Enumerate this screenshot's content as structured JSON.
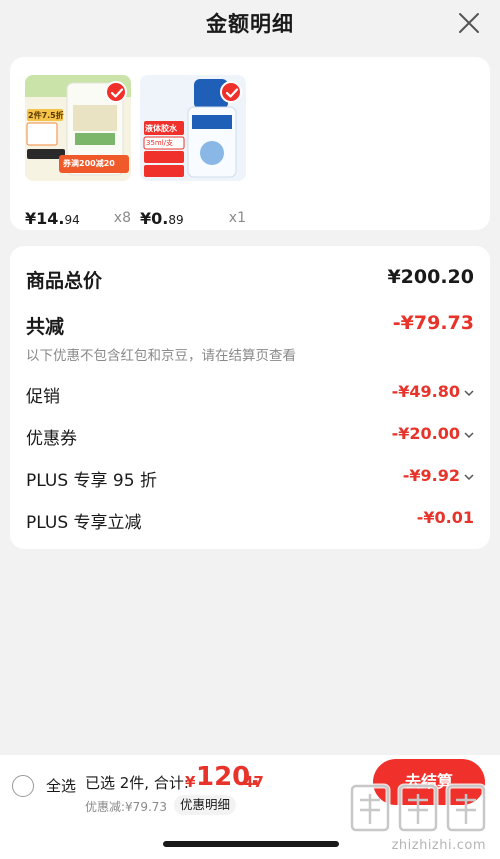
{
  "header": {
    "title": "金额明细"
  },
  "products": [
    {
      "name": "product-milk-powder",
      "price_int": "¥14.",
      "price_dec": "94",
      "qty": "x8",
      "badge": "2件7.5折",
      "promo_text": "券满200减20"
    },
    {
      "name": "product-liquid-glue",
      "price_int": "¥0.",
      "price_dec": "89",
      "qty": "x1",
      "badge": "液体胶水",
      "promo_text": "35ml/支"
    }
  ],
  "summary": {
    "total_label": "商品总价",
    "total_value": "¥200.20",
    "reduce_label": "共减",
    "reduce_value": "-¥79.73",
    "note": "以下优惠不包含红包和京豆，请在结算页查看",
    "items": [
      {
        "label": "促销",
        "value": "-¥49.80"
      },
      {
        "label": "优惠券",
        "value": "-¥20.00"
      },
      {
        "label": "PLUS 专享 95 折",
        "value": "-¥9.92"
      },
      {
        "label": "PLUS 专享立减",
        "value": "-¥0.01"
      }
    ]
  },
  "footer": {
    "select_all": "全选",
    "selected_text": "已选 2件, 合计:",
    "currency": "¥",
    "total_int": "120.",
    "total_dec": "47",
    "discount_text": "优惠减:¥79.73",
    "detail_link": "优惠明细",
    "checkout": "去结算"
  },
  "watermark": {
    "logo": "值值值",
    "text": "zhizhizhi.com"
  },
  "colors": {
    "accent": "#f0302a",
    "price_red": "#e8332a",
    "background": "#f2f2f2"
  }
}
